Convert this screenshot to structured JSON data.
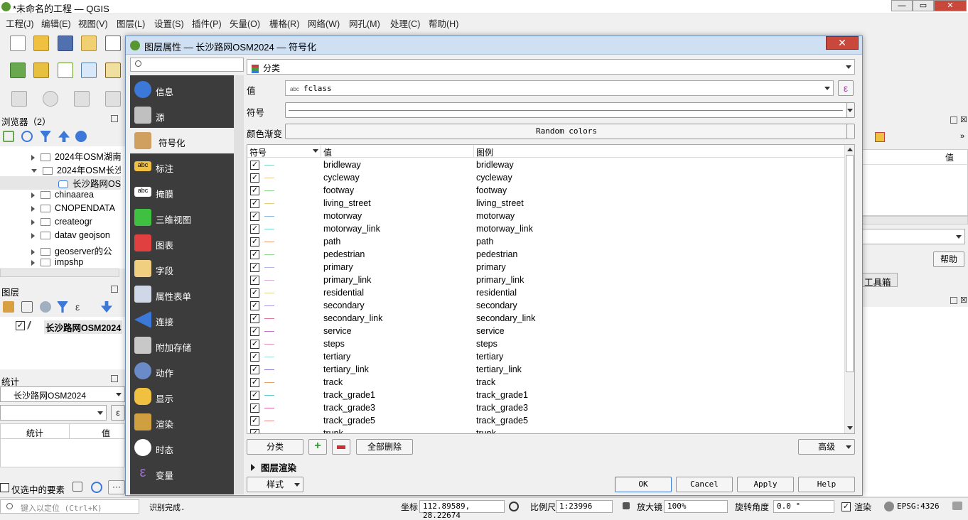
{
  "window": {
    "title": "*未命名的工程 — QGIS"
  },
  "menubar": [
    "工程(J)",
    "编辑(E)",
    "视图(V)",
    "图层(L)",
    "设置(S)",
    "插件(P)",
    "矢量(O)",
    "栅格(R)",
    "网络(W)",
    "网孔(M)",
    "处理(C)",
    "帮助(H)"
  ],
  "browser": {
    "title": "浏览器（2）",
    "items": [
      "2024年OSM湖南",
      "2024年OSM长沙",
      "长沙路网OS",
      "chinaarea",
      "CNOPENDATA",
      "createogr",
      "datav geojson",
      "geoserver的公",
      "impshp"
    ]
  },
  "layers": {
    "title": "图层",
    "item": "长沙路网OSM2024"
  },
  "stats": {
    "title": "统计",
    "layer": "长沙路网OSM2024",
    "col_stat": "统计",
    "col_value": "值",
    "selected_only": "仅选中的要素"
  },
  "right": {
    "col_value": "值",
    "help": "帮助",
    "toolbox": "工具箱"
  },
  "dialog": {
    "title": "图层属性 — 长沙路网OSM2024 — 符号化",
    "renderer": "分类",
    "value_label": "值",
    "value_field": "fclass",
    "value_badge": "abc",
    "symbol_label": "符号",
    "ramp_label": "颜色渐变",
    "ramp_value": "Random colors",
    "table_headers": {
      "symbol": "符号",
      "value": "值",
      "legend": "图例"
    },
    "buttons": {
      "classify": "分类",
      "delete_all": "全部删除",
      "advanced": "高级",
      "layer_render": "图层渲染",
      "style": "样式",
      "ok": "OK",
      "cancel": "Cancel",
      "apply": "Apply",
      "help": "Help"
    },
    "sidebar": [
      "信息",
      "源",
      "符号化",
      "标注",
      "掩膜",
      "三维视图",
      "图表",
      "字段",
      "属性表单",
      "连接",
      "附加存储",
      "动作",
      "显示",
      "渲染",
      "时态",
      "变量"
    ],
    "categories": [
      {
        "value": "bridleway",
        "legend": "bridleway",
        "color": "#7fd8c0"
      },
      {
        "value": "cycleway",
        "legend": "cycleway",
        "color": "#e8c89a"
      },
      {
        "value": "footway",
        "legend": "footway",
        "color": "#8fd48f"
      },
      {
        "value": "living_street",
        "legend": "living_street",
        "color": "#e8d07a"
      },
      {
        "value": "motorway",
        "legend": "motorway",
        "color": "#8ab8e0"
      },
      {
        "value": "motorway_link",
        "legend": "motorway_link",
        "color": "#7ad8d8"
      },
      {
        "value": "path",
        "legend": "path",
        "color": "#e8a080"
      },
      {
        "value": "pedestrian",
        "legend": "pedestrian",
        "color": "#90d890"
      },
      {
        "value": "primary",
        "legend": "primary",
        "color": "#b0b8e8"
      },
      {
        "value": "primary_link",
        "legend": "primary_link",
        "color": "#d8a8d8"
      },
      {
        "value": "residential",
        "legend": "residential",
        "color": "#d8d890"
      },
      {
        "value": "secondary",
        "legend": "secondary",
        "color": "#a898e8"
      },
      {
        "value": "secondary_link",
        "legend": "secondary_link",
        "color": "#e0709c"
      },
      {
        "value": "service",
        "legend": "service",
        "color": "#c870c8"
      },
      {
        "value": "steps",
        "legend": "steps",
        "color": "#e890b0"
      },
      {
        "value": "tertiary",
        "legend": "tertiary",
        "color": "#a0e0d8"
      },
      {
        "value": "tertiary_link",
        "legend": "tertiary_link",
        "color": "#8878d8"
      },
      {
        "value": "track",
        "legend": "track",
        "color": "#e8a060"
      },
      {
        "value": "track_grade1",
        "legend": "track_grade1",
        "color": "#60c8c8"
      },
      {
        "value": "track_grade3",
        "legend": "track_grade3",
        "color": "#e870a0"
      },
      {
        "value": "track_grade5",
        "legend": "track_grade5",
        "color": "#e89090"
      },
      {
        "value": "trunk",
        "legend": "trunk",
        "color": "#a090e0"
      }
    ]
  },
  "statusbar": {
    "search_placeholder": "键入以定位 (Ctrl+K)",
    "message": "识别完成.",
    "coord_label": "坐标",
    "coord_value": "112.89589, 28.22674",
    "scale_label": "比例尺",
    "scale_value": "1:23996",
    "magnifier_label": "放大镜",
    "magnifier_value": "100%",
    "rotation_label": "旋转角度",
    "rotation_value": "0.0 °",
    "render_label": "渲染",
    "crs": "EPSG:4326"
  }
}
